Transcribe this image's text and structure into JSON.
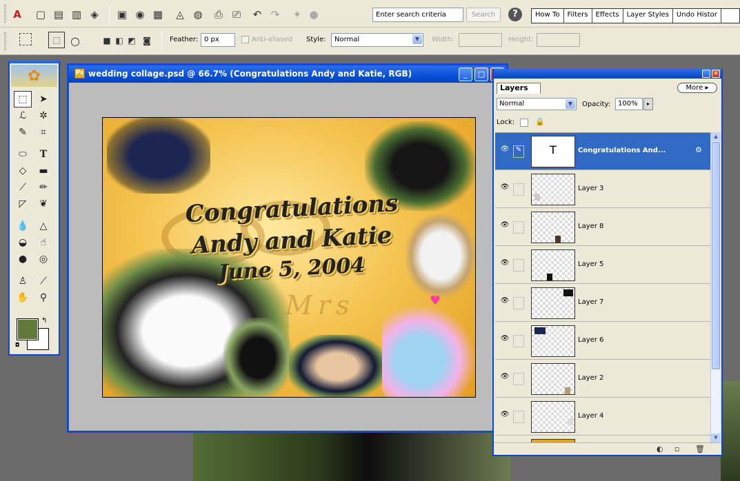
{
  "toolbar": {
    "search_value": "Enter search criteria",
    "search_button": "Search",
    "help": "?",
    "palette_wells": [
      "How To",
      "Filters",
      "Effects",
      "Layer Styles",
      "Undo Histor"
    ]
  },
  "options": {
    "feather_label": "Feather:",
    "feather_value": "0 px",
    "antialiased": "Anti-aliased",
    "style_label": "Style:",
    "style_value": "Normal",
    "width_label": "Width:",
    "height_label": "Height:"
  },
  "colors": {
    "foreground": "#617a3b",
    "background": "#ffffff",
    "title_bar": "#0a4dd8",
    "selection": "#316ac5"
  },
  "document": {
    "title": "wedding collage.psd @ 66.7% (Congratulations Andy and Katie, RGB)",
    "artwork_text": [
      "Congratulations",
      "Andy and Katie",
      "June 5, 2004"
    ],
    "watermark_text": "Mr & Mrs"
  },
  "layers_panel": {
    "tab": "Layers",
    "more": "More",
    "blend_mode": "Normal",
    "opacity_label": "Opacity:",
    "opacity_value": "100%",
    "lock_label": "Lock:",
    "layers": [
      {
        "name": "Congratulations And...",
        "visible": true,
        "selected": true,
        "type": "text"
      },
      {
        "name": "Layer 3",
        "visible": true,
        "selected": false
      },
      {
        "name": "Layer 8",
        "visible": true,
        "selected": false
      },
      {
        "name": "Layer 5",
        "visible": true,
        "selected": false
      },
      {
        "name": "Layer 7",
        "visible": true,
        "selected": false
      },
      {
        "name": "Layer 6",
        "visible": true,
        "selected": false
      },
      {
        "name": "Layer 2",
        "visible": true,
        "selected": false
      },
      {
        "name": "Layer 4",
        "visible": true,
        "selected": false
      }
    ]
  },
  "icons": [
    "adobe-logo-icon",
    "new-file-icon",
    "open-icon",
    "save-icon",
    "print-icon",
    "undo-icon",
    "redo-icon",
    "help-icon",
    "marquee-icon",
    "move-icon",
    "lasso-icon",
    "magic-wand-icon",
    "crop-icon",
    "brush-icon",
    "text-icon",
    "eye-icon",
    "lock-icon",
    "trash-icon"
  ]
}
